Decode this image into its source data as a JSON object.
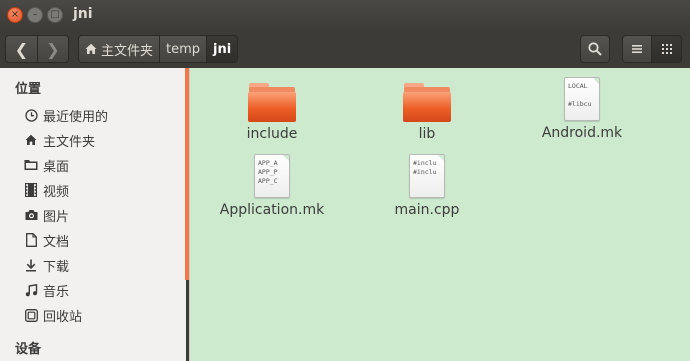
{
  "window": {
    "title": "jni",
    "close_glyph": "×",
    "minimize_glyph": "–",
    "maximize_glyph": "□"
  },
  "toolbar": {
    "back_glyph": "❮",
    "forward_glyph": "❯",
    "breadcrumbs": [
      {
        "label": "主文件夹",
        "icon": "home-icon"
      },
      {
        "label": "temp"
      },
      {
        "label": "jni",
        "active": true
      }
    ],
    "search_icon": "search-icon",
    "list_view_icon": "list-view-icon",
    "grid_view_icon": "grid-view-icon"
  },
  "sidebar": {
    "section_places": "位置",
    "items": [
      {
        "label": "最近使用的",
        "icon": "clock-icon"
      },
      {
        "label": "主文件夹",
        "icon": "home-icon"
      },
      {
        "label": "桌面",
        "icon": "desktop-folder-icon"
      },
      {
        "label": "视频",
        "icon": "film-icon"
      },
      {
        "label": "图片",
        "icon": "camera-icon"
      },
      {
        "label": "文档",
        "icon": "document-icon"
      },
      {
        "label": "下载",
        "icon": "download-icon"
      },
      {
        "label": "音乐",
        "icon": "music-note-icon"
      },
      {
        "label": "回收站",
        "icon": "trash-icon"
      }
    ],
    "section_devices": "设备"
  },
  "files": [
    {
      "name": "include",
      "type": "folder"
    },
    {
      "name": "lib",
      "type": "folder"
    },
    {
      "name": "Android.mk",
      "type": "text",
      "preview": "LOCAL\n\n#libcu"
    },
    {
      "name": "Application.mk",
      "type": "text",
      "preview": "APP_A\nAPP_P\nAPP_C"
    },
    {
      "name": "main.cpp",
      "type": "text",
      "preview": "#inclu\n#inclu"
    }
  ],
  "colors": {
    "accent": "#f07746",
    "main_background": "#cdeacf",
    "titlebar": "#3c3b37"
  }
}
